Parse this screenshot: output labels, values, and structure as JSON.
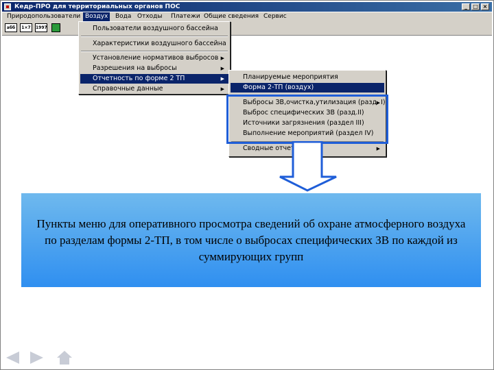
{
  "window": {
    "title": "Кедр-ПРО для территориальных органов ПОС",
    "buttons": {
      "minimize": "_",
      "maximize": "□",
      "close": "×"
    }
  },
  "menubar": {
    "items": [
      {
        "label": "Природопользователи"
      },
      {
        "label": "Воздух",
        "active": true
      },
      {
        "label": "Вода"
      },
      {
        "label": "Отходы"
      },
      {
        "label": "Платежи"
      },
      {
        "label": "Общие сведения"
      },
      {
        "label": "Сервис"
      }
    ]
  },
  "toolbar": {
    "buttons": [
      "абб",
      "1×7",
      "1997",
      ""
    ]
  },
  "menu_air": {
    "items": [
      {
        "label": "Пользователи воздушного бассейна"
      },
      {
        "label": "Характеристики воздушного бассейна"
      },
      {
        "label": "Установление нормативов выбросов",
        "submenu": true
      },
      {
        "label": "Разрешения на выбросы",
        "submenu": true
      },
      {
        "label": "Отчетность по форме 2 ТП",
        "submenu": true,
        "highlighted": true
      },
      {
        "label": "Справочные данные",
        "submenu": true
      }
    ]
  },
  "submenu_2tp": {
    "items": [
      {
        "label": "Планируемые мероприятия"
      },
      {
        "label": "Форма 2-ТП (воздух)",
        "highlighted": true
      },
      {
        "label": "Выбросы ЗВ,очистка,утилизация (разд. I)",
        "submenu": true
      },
      {
        "label": "Выброс специфических ЗВ (разд.II)"
      },
      {
        "label": "Источники загрязнения (раздел III)"
      },
      {
        "label": "Выполнение мероприятий (раздел IV)"
      },
      {
        "label": "Сводные отчеты",
        "submenu": true
      }
    ]
  },
  "callout": {
    "text": "Пункты меню для оперативного просмотра сведений об охране атмосферного воздуха по разделам  формы 2-ТП, в том числе о выбросах специфических ЗВ по каждой из суммирующих групп"
  },
  "colors": {
    "highlight": "#0a246a",
    "frame": "#1f5ed8",
    "callout_top": "#6fb9ee",
    "callout_bottom": "#2f8ff0"
  },
  "navigation": {
    "icons": [
      "back-arrow-icon",
      "forward-arrow-icon",
      "home-icon"
    ]
  }
}
